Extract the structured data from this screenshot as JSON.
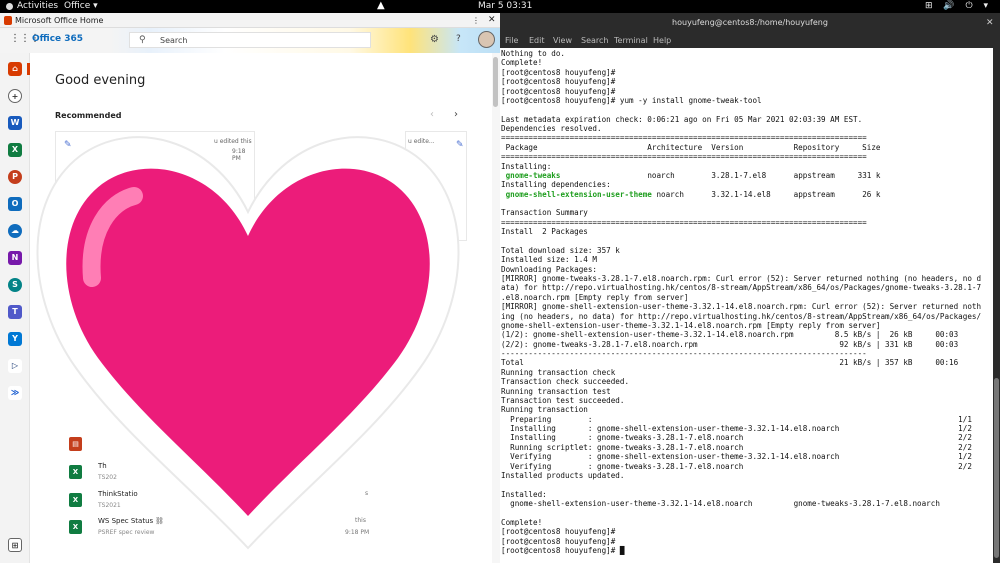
{
  "topbar": {
    "activities": "Activities",
    "app_menu": "Office ▾",
    "clock": "Mar 5  03:31",
    "tray": "⊞ 🔊 ⏻ ▾"
  },
  "browser": {
    "window_title": "Microsoft Office Home",
    "more_label": "⋮",
    "close_label": "✕",
    "brand": "Office 365",
    "search_placeholder": "Search",
    "greeting": "Good evening",
    "recommended": "Recommended",
    "cards": [
      {
        "meta": "u edited this",
        "date": "9:18 PM"
      },
      {
        "meta": "u edite..."
      }
    ],
    "files": [
      {
        "name": "Th",
        "sub": "TS202",
        "right": "",
        "date": ""
      },
      {
        "name": "ThinkStatio",
        "sub": "TS2021",
        "right": "s",
        "date": ""
      },
      {
        "name": "WS Spec Status",
        "sub": "PSREF spec review",
        "right": "this",
        "date": "9:18 PM",
        "shared": "⛓"
      }
    ]
  },
  "terminal": {
    "title": "houyufeng@centos8:/home/houyufeng",
    "close_label": "✕",
    "menu": [
      "File",
      "Edit",
      "View",
      "Search",
      "Terminal",
      "Help"
    ],
    "lines": [
      "Nothing to do.",
      "Complete!",
      "[root@centos8 houyufeng]#",
      "[root@centos8 houyufeng]#",
      "[root@centos8 houyufeng]#",
      "[root@centos8 houyufeng]# yum -y install gnome-tweak-tool",
      "",
      "Last metadata expiration check: 0:06:21 ago on Fri 05 Mar 2021 02:03:39 AM EST.",
      "Dependencies resolved.",
      "================================================================================",
      " Package                        Architecture  Version           Repository     Size",
      "================================================================================",
      "Installing:",
      " gnome-tweaks                   noarch        3.28.1-7.el8      appstream     331 k",
      "Installing dependencies:",
      " gnome-shell-extension-user-theme noarch      3.32.1-14.el8     appstream      26 k",
      "",
      "Transaction Summary",
      "================================================================================",
      "Install  2 Packages",
      "",
      "Total download size: 357 k",
      "Installed size: 1.4 M",
      "Downloading Packages:",
      "[MIRROR] gnome-tweaks-3.28.1-7.el8.noarch.rpm: Curl error (52): Server returned nothing (no headers, no d",
      "ata) for http://repo.virtualhosting.hk/centos/8-stream/AppStream/x86_64/os/Packages/gnome-tweaks-3.28.1-7",
      ".el8.noarch.rpm [Empty reply from server]",
      "[MIRROR] gnome-shell-extension-user-theme-3.32.1-14.el8.noarch.rpm: Curl error (52): Server returned noth",
      "ing (no headers, no data) for http://repo.virtualhosting.hk/centos/8-stream/AppStream/x86_64/os/Packages/",
      "gnome-shell-extension-user-theme-3.32.1-14.el8.noarch.rpm [Empty reply from server]",
      "(1/2): gnome-shell-extension-user-theme-3.32.1-14.el8.noarch.rpm         8.5 kB/s |  26 kB     00:03",
      "(2/2): gnome-tweaks-3.28.1-7.el8.noarch.rpm                               92 kB/s | 331 kB     00:03",
      "--------------------------------------------------------------------------------",
      "Total                                                                     21 kB/s | 357 kB     00:16",
      "Running transaction check",
      "Transaction check succeeded.",
      "Running transaction test",
      "Transaction test succeeded.",
      "Running transaction",
      "  Preparing        :                                                                                1/1",
      "  Installing       : gnome-shell-extension-user-theme-3.32.1-14.el8.noarch                          1/2",
      "  Installing       : gnome-tweaks-3.28.1-7.el8.noarch                                               2/2",
      "  Running scriptlet: gnome-tweaks-3.28.1-7.el8.noarch                                               2/2",
      "  Verifying        : gnome-shell-extension-user-theme-3.32.1-14.el8.noarch                          1/2",
      "  Verifying        : gnome-tweaks-3.28.1-7.el8.noarch                                               2/2",
      "Installed products updated.",
      "",
      "Installed:",
      "  gnome-shell-extension-user-theme-3.32.1-14.el8.noarch         gnome-tweaks-3.28.1-7.el8.noarch",
      "",
      "Complete!",
      "[root@centos8 houyufeng]#",
      "[root@centos8 houyufeng]#",
      "[root@centos8 houyufeng]# █"
    ],
    "green_lines": [
      13,
      15
    ]
  },
  "colors": {
    "heart": "#ec1c7a",
    "terminal_bg": "#ffffff",
    "office_accent": "#d83b01",
    "package_highlight": "#1f9e1f"
  },
  "icons": {
    "heart": "heart-sticker-icon",
    "waffle": "app-launcher-icon",
    "search": "search-icon",
    "settings": "gear-icon",
    "help": "help-icon"
  }
}
